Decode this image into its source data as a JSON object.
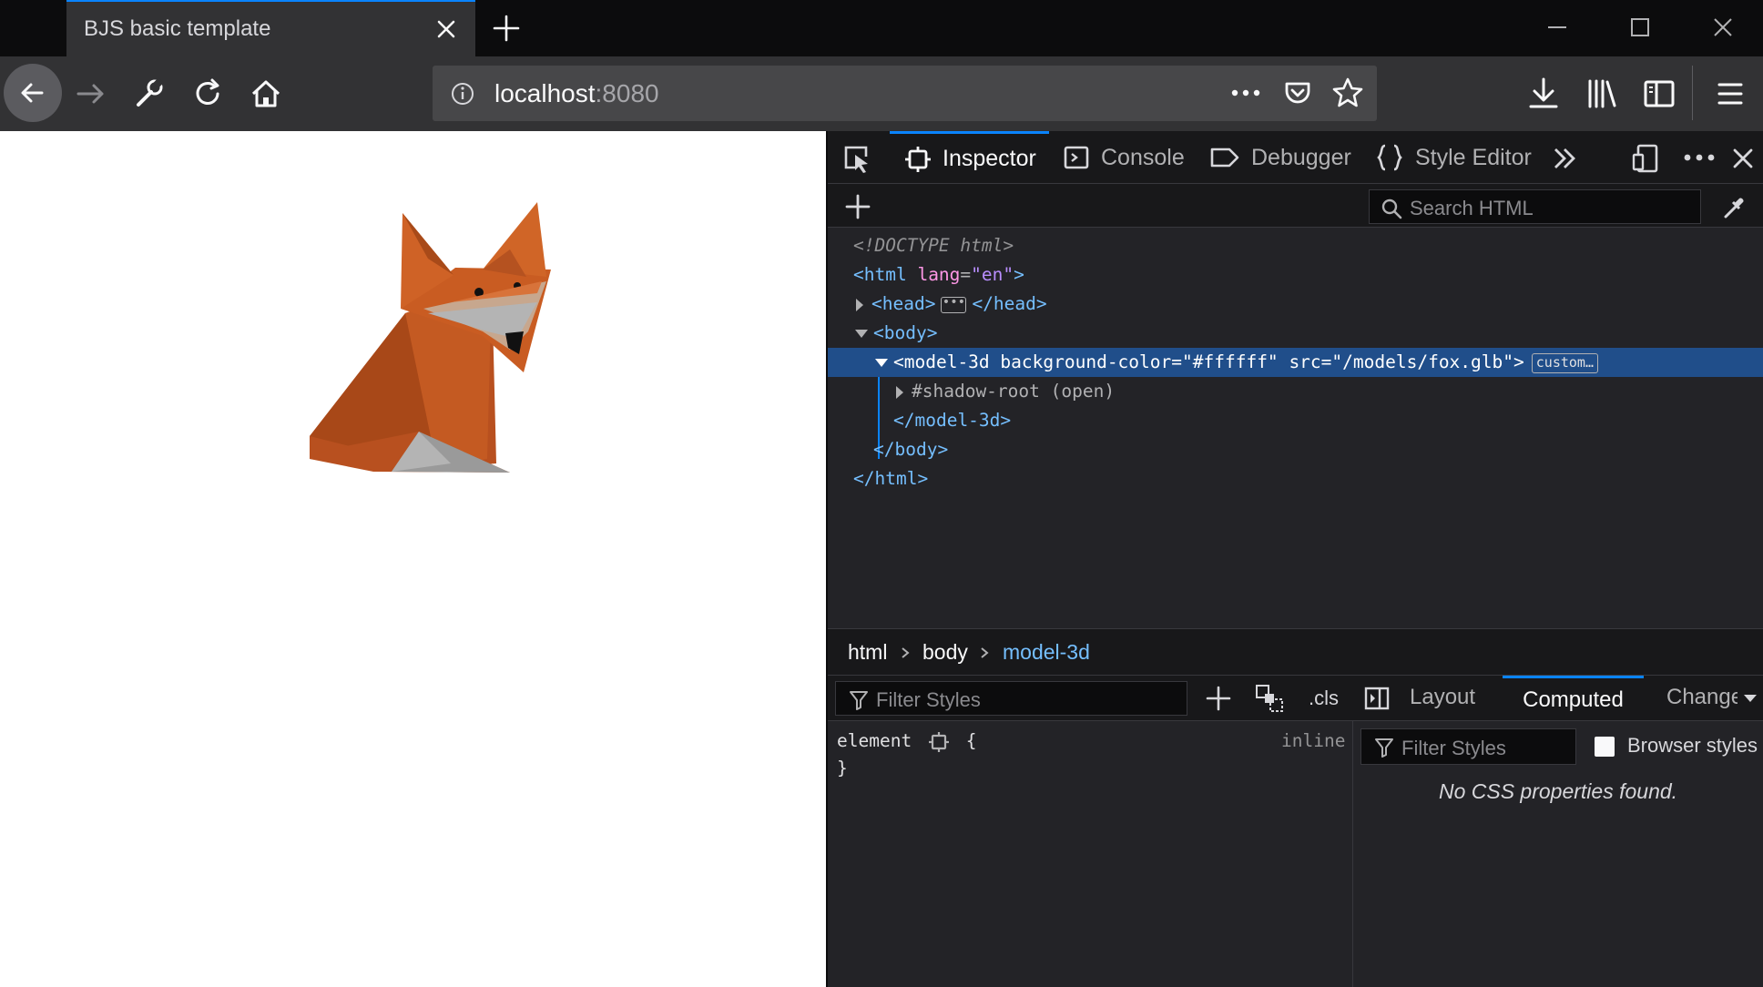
{
  "tab": {
    "title": "BJS basic template"
  },
  "urlbar": {
    "host": "localhost",
    "port": ":8080"
  },
  "devtools": {
    "tabs": [
      {
        "label": "Inspector",
        "icon": "inspector-icon"
      },
      {
        "label": "Console",
        "icon": "console-icon"
      },
      {
        "label": "Debugger",
        "icon": "debugger-icon"
      },
      {
        "label": "Style Editor",
        "icon": "style-editor-icon"
      }
    ],
    "search_placeholder": "Search HTML",
    "markup": {
      "doctype": "<!DOCTYPE html>",
      "html_open_tag": "<html",
      "html_attr": "lang",
      "html_val": "\"en\"",
      "head_open": "<head>",
      "head_close": "</head>",
      "body_open": "<body>",
      "model_tag": "<model-3d",
      "model_attr1": "background-color",
      "model_val1": "\"#ffffff\"",
      "model_attr2": "src",
      "model_val2": "\"/models/fox.glb\"",
      "model_badge": "custom…",
      "shadow_root": "#shadow-root (open)",
      "model_close": "</model-3d>",
      "body_close": "</body>",
      "html_close": "</html>"
    },
    "breadcrumbs": [
      "html",
      "body",
      "model-3d"
    ],
    "rules": {
      "filter_placeholder": "Filter Styles",
      "cls_label": ".cls",
      "element_selector": "element",
      "open_brace": "{",
      "close_brace": "}",
      "source": "inline"
    },
    "computed": {
      "tabs": [
        "Layout",
        "Computed",
        "Changes"
      ],
      "active_tab": "Computed",
      "filter_placeholder": "Filter Styles",
      "browser_styles_label": "Browser styles",
      "browser_styles_checked": false,
      "empty_message": "No CSS properties found."
    }
  }
}
